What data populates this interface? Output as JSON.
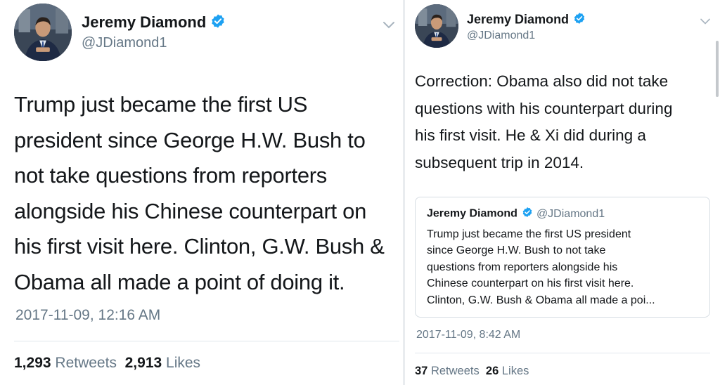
{
  "left_tweet": {
    "author_name": "Jeremy Diamond",
    "handle": "@JDiamond1",
    "verified_icon": "verified-badge-icon",
    "menu_icon": "chevron-down-icon",
    "text_lines": [
      "Trump just became the first US",
      "president since George H.W. Bush to",
      "not take questions from reporters",
      "alongside his Chinese counterpart on",
      "his first visit here. Clinton, G.W. Bush &",
      "Obama all made a point of doing it."
    ],
    "timestamp": "2017-11-09, 12:16 AM",
    "retweets_count": "1,293",
    "retweets_label": "Retweets",
    "likes_count": "2,913",
    "likes_label": "Likes"
  },
  "right_tweet": {
    "author_name": "Jeremy Diamond",
    "handle": "@JDiamond1",
    "verified_icon": "verified-badge-icon",
    "menu_icon": "chevron-down-icon",
    "text_lines": [
      "Correction: Obama also did not take",
      "questions with his counterpart during",
      "his first visit. He & Xi did during a",
      "subsequent trip in 2014."
    ],
    "quoted_tweet": {
      "author_name": "Jeremy Diamond",
      "handle": "@JDiamond1",
      "text_lines": [
        "Trump just became the first US president",
        "since George H.W. Bush to not take",
        "questions from reporters alongside his",
        "Chinese counterpart on his first visit here.",
        "Clinton, G.W. Bush & Obama all made a poi..."
      ]
    },
    "timestamp": "2017-11-09, 8:42 AM",
    "retweets_count": "37",
    "retweets_label": "Retweets",
    "likes_count": "26",
    "likes_label": "Likes"
  },
  "colors": {
    "text": "#14171a",
    "secondary": "#657786",
    "verified": "#1da1f2",
    "border": "#e1e8ed"
  }
}
